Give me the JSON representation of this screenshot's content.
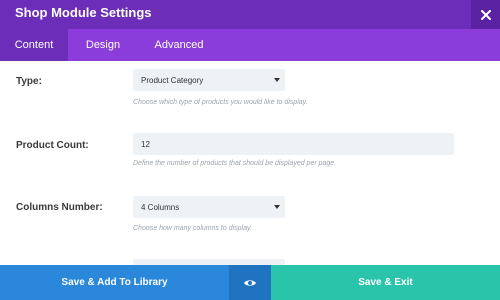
{
  "window": {
    "title": "Shop Module Settings",
    "close_icon": "close-icon"
  },
  "tabs": [
    {
      "label": "Content",
      "active": true
    },
    {
      "label": "Design",
      "active": false
    },
    {
      "label": "Advanced",
      "active": false
    }
  ],
  "fields": {
    "type": {
      "label": "Type:",
      "value": "Product Category",
      "description": "Choose which type of products you would like to display."
    },
    "product_count": {
      "label": "Product Count:",
      "value": "12",
      "description": "Define the number of products that should be displayed per page."
    },
    "columns_number": {
      "label": "Columns Number:",
      "value": "4 Columns",
      "description": "Choose how many columns to display."
    }
  },
  "footer": {
    "library_label": "Save & Add To Library",
    "eye_icon": "eye-icon",
    "save_label": "Save & Exit"
  },
  "colors": {
    "title_bar": "#6c2eb9",
    "tab_bar": "#8b3ddb",
    "library_button": "#2b87da",
    "eye_button": "#2073bf",
    "save_button": "#29c4a9"
  }
}
